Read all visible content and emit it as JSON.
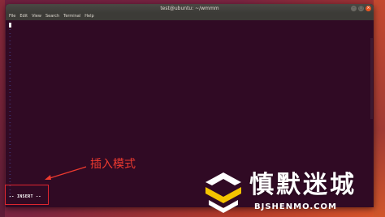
{
  "window": {
    "title": "test@ubuntu: ~/wmmm",
    "controls": [
      "minimize",
      "maximize",
      "close"
    ]
  },
  "menubar": {
    "items": [
      "File",
      "Edit",
      "View",
      "Search",
      "Terminal",
      "Help"
    ]
  },
  "editor": {
    "empty_line_marker": "~",
    "mode_line": "-- INSERT --"
  },
  "annotation": {
    "label": "插入模式",
    "color": "#ee3a2f"
  },
  "watermark": {
    "title": "慎默迷城",
    "url": "BJSHENMO.COM"
  },
  "colors": {
    "terminal_bg": "#300a24",
    "titlebar_bg": "#3c3b37",
    "tilde": "#4f56ad",
    "close_button": "#e95420",
    "highlight_box": "#e0262f"
  }
}
